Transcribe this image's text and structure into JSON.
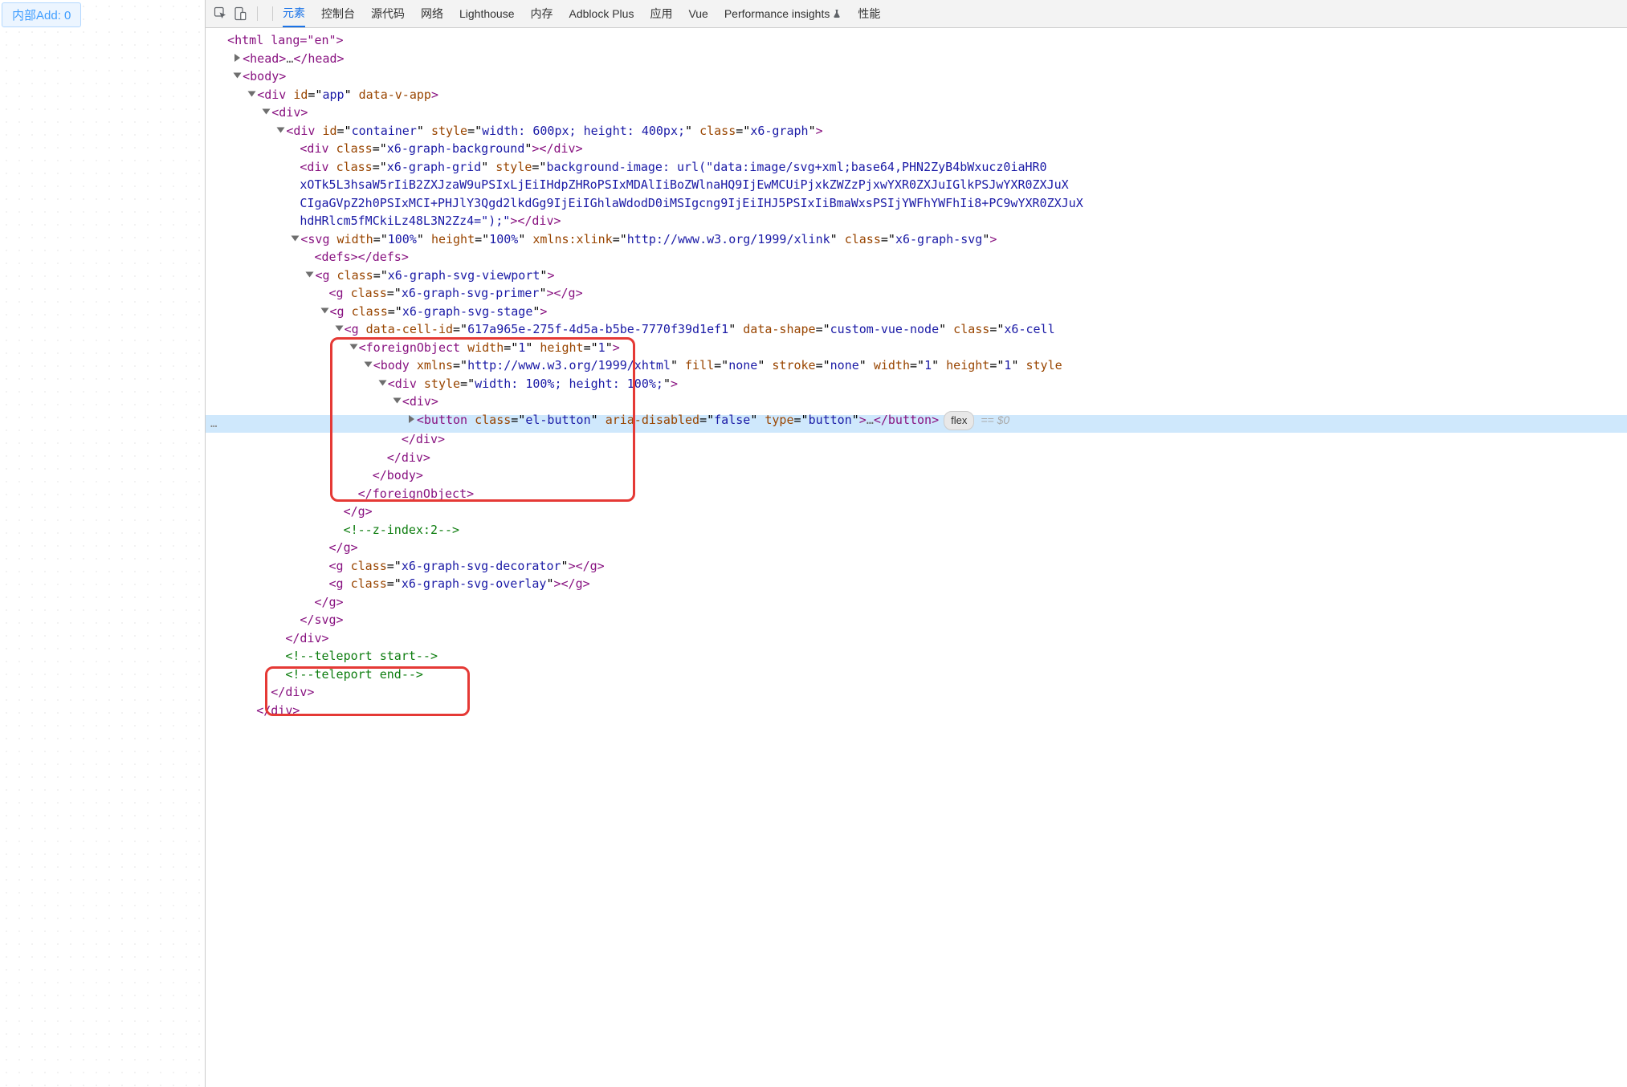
{
  "left": {
    "button_label": "内部Add: 0"
  },
  "tabs": {
    "elements": "元素",
    "console": "控制台",
    "sources": "源代码",
    "network": "网络",
    "lighthouse": "Lighthouse",
    "memory": "内存",
    "adblock": "Adblock Plus",
    "application": "应用",
    "vue": "Vue",
    "perf": "Performance insights",
    "performance": "性能"
  },
  "dom": {
    "l0": "<html lang=\"en\">",
    "head_open": "<head>",
    "head_ell": "…",
    "head_close": "</head>",
    "body": "<body>",
    "div_app_open": "<div",
    "div_app_id_n": "id",
    "div_app_id_v": "app",
    "div_app_dv_n": "data-v-app",
    "div_app_close": ">",
    "div": "<div>",
    "container_open": "<div",
    "id_n": "id",
    "id_v": "container",
    "style_n": "style",
    "container_style": "width: 600px; height: 400px;",
    "class_n": "class",
    "container_cls": "x6-graph",
    "gt": ">",
    "bg": "<div",
    "bg_cls": "x6-graph-background",
    "divc": "></div>",
    "grid": "<div",
    "grid_cls": "x6-graph-grid",
    "grid_style": "background-image: url(\"data:image/svg+xml;base64,PHN2ZyB4bWxucz0iaHR0",
    "grid2": "xOTk5L3hsaW5rIiB2ZXJzaW9uPSIxLjEiIHdpZHRoPSIxMDAlIiBoZWlnaHQ9IjEwMCUiPjxkZWZzPjxwYXR0ZXJuIGlkPSJwYXR0ZXJuX",
    "grid3": "CIgaGVpZ2h0PSIxMCI+PHJlY3Qgd2lkdGg9IjEiIGhlaWdodD0iMSIgcng9IjEiIHJ5PSIxIiBmaWxsPSIjYWFhYWFhIi8+PC9wYXR0ZXJuX",
    "grid4": "hdHRlcm5fMCkiLz48L3N2Zz4=\");\"",
    "grid_c": "></div>",
    "svg": "<svg",
    "w_n": "width",
    "w_v": "100%",
    "h_n": "height",
    "h_v": "100%",
    "xl_n": "xmlns:xlink",
    "xl_v": "http://www.w3.org/1999/xlink",
    "svg_cls": "x6-graph-svg",
    "defs": "<defs></defs>",
    "g": "<g",
    "vp_cls": "x6-graph-svg-viewport",
    "primer_cls": "x6-graph-svg-primer",
    "gc": "></g>",
    "stage_cls": "x6-graph-svg-stage",
    "cell_n": "data-cell-id",
    "cell_v": "617a965e-275f-4d5a-b5be-7770f39d1ef1",
    "shape_n": "data-shape",
    "shape_v": "custom-vue-node",
    "cell_cls": "x6-cell",
    "fo": "<foreignObject",
    "one": "1",
    "body_e": "<body",
    "xmlns_n": "xmlns",
    "xmlns_v": "http://www.w3.org/1999/xhtml",
    "fill_n": "fill",
    "none": "none",
    "stroke_n": "stroke",
    "styl": "style",
    "div_s": "width: 100%; height: 100%;",
    "btn": "<button",
    "btn_cls": "el-button",
    "aria_n": "aria-disabled",
    "false": "false",
    "type_n": "type",
    "type_v": "button",
    "btnc": "</button>",
    "divclose": "</div>",
    "bodyc": "</body>",
    "foc": "</foreignObject>",
    "gclose": "</g>",
    "zc": "<!--z-index:2-->",
    "dec_cls": "x6-graph-svg-decorator",
    "ov_cls": "x6-graph-svg-overlay",
    "svgc": "</svg>",
    "tp1": "<!--teleport start-->",
    "tp2": "<!--teleport end-->",
    "flex_badge": "flex",
    "eq": "==",
    "dollar0": "$0"
  }
}
